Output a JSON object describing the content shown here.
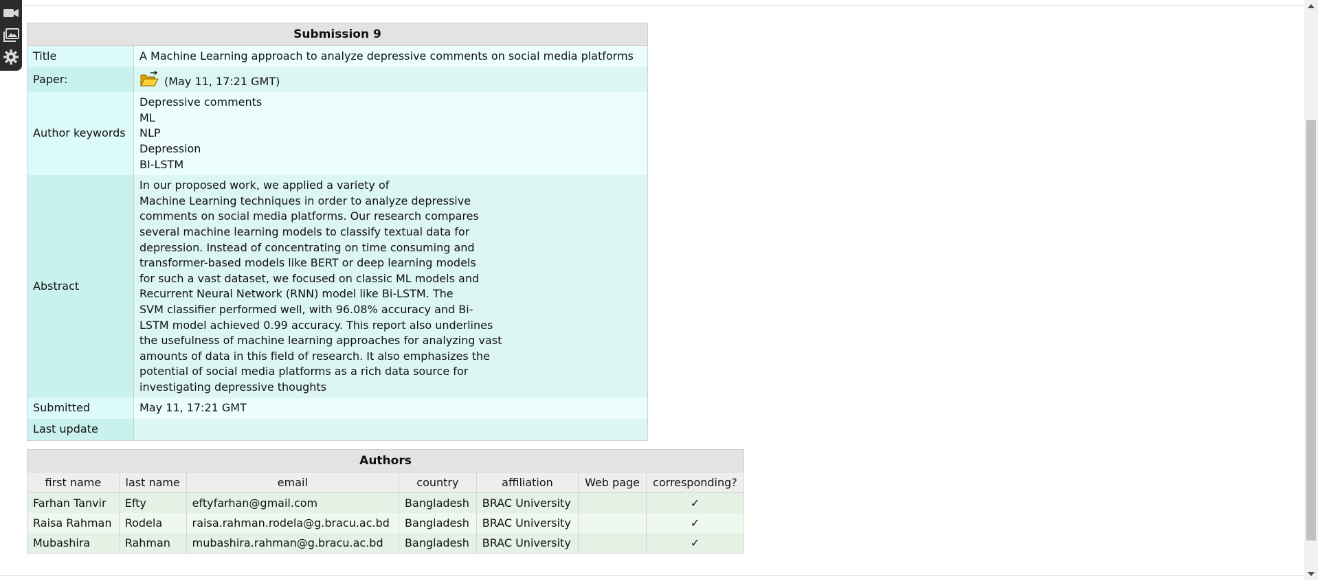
{
  "submission": {
    "heading": "Submission 9",
    "rows": {
      "title_label": "Title",
      "title_value": "A Machine Learning approach to analyze depressive comments on social media platforms",
      "paper_label": "Paper:",
      "paper_value": "(May 11, 17:21 GMT)",
      "keywords_label": "Author keywords",
      "keywords": [
        "Depressive comments",
        "ML",
        "NLP",
        "Depression",
        "BI-LSTM"
      ],
      "abstract_label": "Abstract",
      "abstract_lines": [
        "In our proposed work, we applied a variety of",
        "Machine Learning techniques in order to analyze depressive",
        "comments on social media platforms. Our research compares",
        "several machine learning models to classify textual data for",
        "depression. Instead of concentrating on time consuming and",
        "transformer-based models like BERT or deep learning models",
        "for such a vast dataset, we focused on classic ML models and",
        "Recurrent Neural Network (RNN) model like Bi-LSTM. The",
        "SVM classifier performed well, with 96.08% accuracy and Bi-",
        "LSTM model achieved 0.99 accuracy. This report also underlines",
        "the usefulness of machine learning approaches for analyzing vast",
        "amounts of data in this field of research. It also emphasizes the",
        "potential of social media platforms as a rich data source for",
        "investigating depressive thoughts"
      ],
      "submitted_label": "Submitted",
      "submitted_value": "May 11, 17:21 GMT",
      "last_update_label": "Last update",
      "last_update_value": ""
    }
  },
  "authors": {
    "heading": "Authors",
    "columns": [
      "first name",
      "last name",
      "email",
      "country",
      "affiliation",
      "Web page",
      "corresponding?"
    ],
    "rows": [
      {
        "first": "Farhan Tanvir",
        "last": "Efty",
        "email": "eftyfarhan@gmail.com",
        "country": "Bangladesh",
        "affiliation": "BRAC University",
        "web": "",
        "corr": "✓"
      },
      {
        "first": "Raisa Rahman",
        "last": "Rodela",
        "email": "raisa.rahman.rodela@g.bracu.ac.bd",
        "country": "Bangladesh",
        "affiliation": "BRAC University",
        "web": "",
        "corr": "✓"
      },
      {
        "first": "Mubashira",
        "last": "Rahman",
        "email": "mubashira.rahman@g.bracu.ac.bd",
        "country": "Bangladesh",
        "affiliation": "BRAC University",
        "web": "",
        "corr": "✓"
      }
    ]
  },
  "icons": {
    "toolbar": [
      "video-camera-icon",
      "image-gallery-icon",
      "gear-icon"
    ],
    "paper": "open-folder-icon"
  },
  "colors": {
    "label_light": "#dcfafa",
    "label_dark": "#c9f1ee",
    "row_green_a": "#e5f1e5",
    "row_green_b": "#eef8ee"
  }
}
